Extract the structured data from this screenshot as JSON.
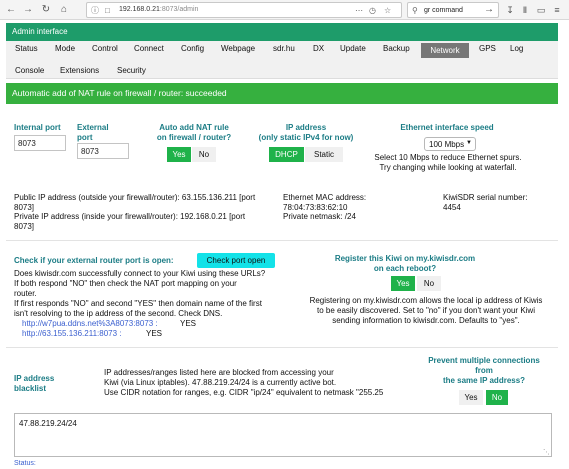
{
  "browser": {
    "url_host": "192.168.0.21",
    "url_rest": ":8073/admin",
    "search_text": "gr command"
  },
  "header": {
    "title": "Admin interface"
  },
  "tabs": {
    "row1": [
      "Status",
      "Mode",
      "Control",
      "Connect",
      "Config",
      "Webpage",
      "sdr.hu",
      "DX",
      "Update",
      "Backup",
      "Network",
      "GPS",
      "Log"
    ],
    "row2": [
      "Console",
      "Extensions",
      "Security"
    ],
    "active": "Network"
  },
  "message": "Automatic add of NAT rule on firewall / router: succeeded",
  "ports": {
    "internal_label": "Internal port",
    "internal_value": "8073",
    "external_label_1": "External",
    "external_label_2": "port",
    "external_value": "8073"
  },
  "nat": {
    "label_1": "Auto add NAT rule",
    "label_2": "on firewall / router?",
    "yes": "Yes",
    "no": "No"
  },
  "ip": {
    "label_1": "IP address",
    "label_2": "(only static IPv4 for now)",
    "dhcp": "DHCP",
    "static": "Static"
  },
  "ethernet": {
    "label": "Ethernet interface speed",
    "selected": "100 Mbps",
    "note_1": "Select 10 Mbps to reduce Ethernet spurs.",
    "note_2": "Try changing while looking at waterfall."
  },
  "info": {
    "public_1": "Public IP address (outside your firewall/router): 63.155.136.211 [port",
    "public_2": "8073]",
    "private_1": "Private IP address (inside your firewall/router): 192.168.0.21 [port",
    "private_2": "8073]",
    "mac_label": "Ethernet MAC address:",
    "mac_value": "78:04:73:83:62:10",
    "netmask": "Private netmask: /24",
    "serial_label": "KiwiSDR serial number:",
    "serial_value": "4454"
  },
  "check": {
    "heading": "Check if your external router port is open:",
    "button": "Check port open",
    "lines": [
      "Does kiwisdr.com successfully connect to your Kiwi using these URLs?",
      "If both respond \"NO\" then check the NAT port mapping on your",
      "router.",
      "If first responds \"NO\" and second \"YES\" then domain name of the first",
      "isn't resolving to the ip address of the second. Check DNS."
    ],
    "url1": "http://w7pua.ddns.net%3A8073:8073 :",
    "url1_result": "YES",
    "url2": "http://63.155.136.211:8073 :",
    "url2_result": "YES"
  },
  "register": {
    "label_1": "Register this Kiwi on my.kiwisdr.com",
    "label_2": "on each reboot?",
    "yes": "Yes",
    "no": "No",
    "desc_1": "Registering on my.kiwisdr.com allows the local ip address of Kiwis",
    "desc_2": "to be easily discovered. Set to \"no\" if you don't want your Kiwi",
    "desc_3": "sending information to kiwisdr.com. Defaults to \"yes\"."
  },
  "blacklist": {
    "label_1": "IP address",
    "label_2": "blacklist",
    "desc_1": "IP addresses/ranges listed here are blocked from accessing your",
    "desc_2": "Kiwi (via Linux iptables). 47.88.219.24/24 is a currently active bot.",
    "desc_3": "Use CIDR notation for ranges, e.g. CIDR \"ip/24\" equivalent to netmask \"255.25",
    "value": "47.88.219.24/24"
  },
  "multi": {
    "label_1": "Prevent multiple connections",
    "label_2": "from",
    "label_3": "the same IP address?",
    "yes": "Yes",
    "no": "No"
  },
  "status_partial": "Status:",
  "colors": {
    "header_green": "#1e9c6a",
    "message_green": "#36b03f",
    "button_green": "#1fb24a",
    "label_teal": "#1b7c85",
    "check_cyan": "#13e2e8",
    "link_blue": "#3a5fcf"
  }
}
